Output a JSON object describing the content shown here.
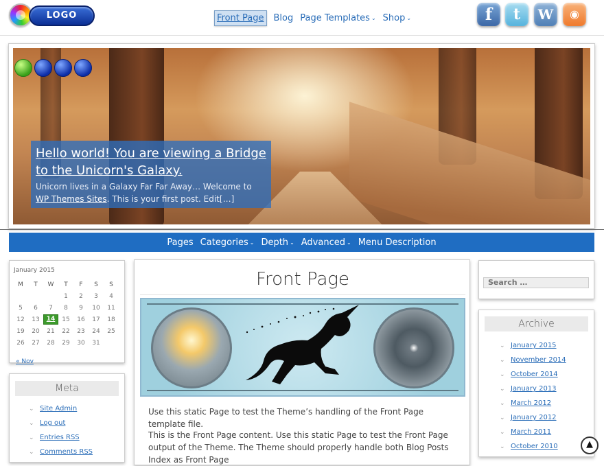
{
  "header": {
    "logo_text": "LOGO",
    "nav": [
      {
        "label": "Front Page",
        "active": true,
        "has_dropdown": false
      },
      {
        "label": "Blog",
        "active": false,
        "has_dropdown": false
      },
      {
        "label": "Page Templates",
        "active": false,
        "has_dropdown": true
      },
      {
        "label": "Shop",
        "active": false,
        "has_dropdown": true
      }
    ],
    "social": [
      {
        "icon": "facebook-icon",
        "glyph": "f",
        "color": "#3b67a6"
      },
      {
        "icon": "twitter-icon",
        "glyph": "t",
        "color": "#55b3dd"
      },
      {
        "icon": "wordpress-icon",
        "glyph": "W",
        "color": "#4f7fb6"
      },
      {
        "icon": "rss-icon",
        "glyph": "◉",
        "color": "#ef7a2c"
      }
    ]
  },
  "hero": {
    "slides": 4,
    "active_slide": 1,
    "title": "Hello world! You are viewing a Bridge to the Unicorn's Galaxy.",
    "excerpt_start": "Unicorn lives in a Galaxy Far Far Away… Welcome to ",
    "excerpt_link": "WP Themes Sites",
    "excerpt_end": ". This is your first post. Edit",
    "excerpt_more": "[…]"
  },
  "secondary_nav": [
    {
      "label": "Pages",
      "has_dropdown": false
    },
    {
      "label": "Categories",
      "has_dropdown": true
    },
    {
      "label": "Depth",
      "has_dropdown": true
    },
    {
      "label": "Advanced",
      "has_dropdown": true
    },
    {
      "label": "Menu Description",
      "has_dropdown": false
    }
  ],
  "calendar": {
    "month": "January 2015",
    "weekdays": [
      "M",
      "T",
      "W",
      "T",
      "F",
      "S",
      "S"
    ],
    "weeks": [
      [
        "",
        "",
        "",
        "1",
        "2",
        "3",
        "4"
      ],
      [
        "5",
        "6",
        "7",
        "8",
        "9",
        "10",
        "11"
      ],
      [
        "12",
        "13",
        "14",
        "15",
        "16",
        "17",
        "18"
      ],
      [
        "19",
        "20",
        "21",
        "22",
        "23",
        "24",
        "25"
      ],
      [
        "26",
        "27",
        "28",
        "29",
        "30",
        "31",
        ""
      ]
    ],
    "today": "14",
    "prev_link": "« Nov"
  },
  "meta": {
    "title": "Meta",
    "items": [
      "Site Admin",
      "Log out",
      "Entries RSS",
      "Comments RSS"
    ]
  },
  "main": {
    "page_title": "Front Page",
    "para1": "Use this static Page to test the Theme’s handling of the Front Page template file.",
    "para2": "This is the Front Page content. Use this static Page to test the Front Page output of the Theme. The Theme should properly handle both Blog Posts Index as Front Page"
  },
  "search": {
    "placeholder": "Search …"
  },
  "archive": {
    "title": "Archive",
    "items": [
      "January 2015",
      "November 2014",
      "October 2014",
      "January 2013",
      "March 2012",
      "January 2012",
      "March 2011",
      "October 2010"
    ]
  },
  "colors": {
    "accent_blue": "#1f6dc2",
    "link_blue": "#2a6db8",
    "today_green": "#3c9a2b"
  }
}
